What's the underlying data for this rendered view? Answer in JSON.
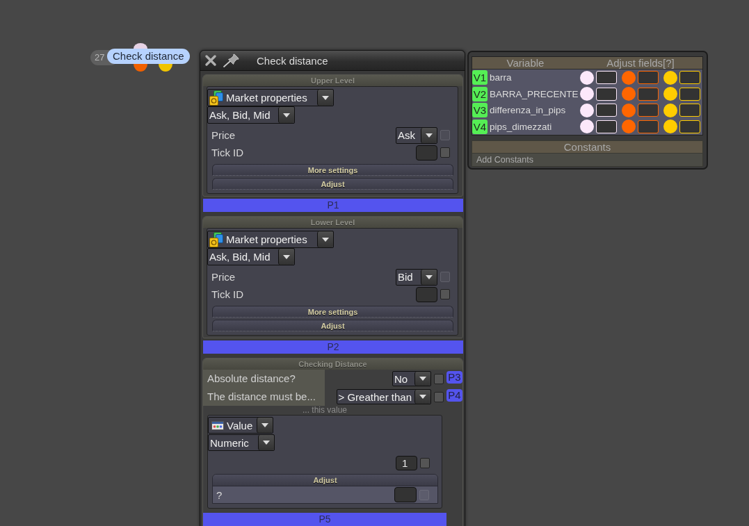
{
  "node": {
    "number": "27",
    "label": "Check distance",
    "ports": [
      {
        "color": "#e6d2e4"
      },
      {
        "color": "#f06000"
      },
      {
        "color": "#f0c400"
      }
    ]
  },
  "window": {
    "title": "Check distance"
  },
  "sections": [
    {
      "kind": "level",
      "title": "Upper Level",
      "source": "Market properties",
      "mode": "Ask, Bid, Mid",
      "fields": [
        {
          "kind": "select",
          "label": "Price",
          "value": "Ask",
          "checked": false,
          "disabled": true
        },
        {
          "kind": "input",
          "label": "Tick ID",
          "checked": false,
          "disabled": false
        }
      ],
      "buttons": [
        "More settings",
        "Adjust"
      ],
      "param": "P1"
    },
    {
      "kind": "level",
      "title": "Lower Level",
      "source": "Market properties",
      "mode": "Ask, Bid, Mid",
      "fields": [
        {
          "kind": "select",
          "label": "Price",
          "value": "Bid",
          "checked": false,
          "disabled": true
        },
        {
          "kind": "input",
          "label": "Tick ID",
          "checked": false,
          "disabled": false
        }
      ],
      "buttons": [
        "More settings",
        "Adjust"
      ],
      "param": "P2"
    },
    {
      "kind": "checks",
      "title": "Checking Distance",
      "rows": [
        {
          "label": "Absolute distance?",
          "value": "No",
          "checked": false,
          "disabled": false,
          "param": "P3"
        },
        {
          "label": "The distance must be...",
          "value": "> Greather than",
          "checked": false,
          "disabled": false,
          "param": "P4"
        }
      ],
      "caption": "... this value",
      "operand": {
        "source": "Value",
        "mode": "Numeric",
        "value": "1",
        "checked": false,
        "disabled": false,
        "adjust": {
          "title": "Adjust",
          "rows": [
            {
              "label": "?",
              "checked": false,
              "disabled": true
            }
          ]
        }
      },
      "param": "P5"
    }
  ],
  "variables": {
    "columns": [
      "Variable",
      "Adjust fields[?]"
    ],
    "slots": [
      {
        "color": "#fce8fa"
      },
      {
        "color": "#ff6600"
      },
      {
        "color": "#ffcc00"
      }
    ],
    "rows": [
      {
        "id": "V1",
        "name": "barra"
      },
      {
        "id": "V2",
        "name": "BARRA_PRECENTE"
      },
      {
        "id": "V3",
        "name": "differenza_in_pips"
      },
      {
        "id": "V4",
        "name": "pips_dimezzati"
      }
    ]
  },
  "constants": {
    "title": "Constants",
    "action": "Add Constants"
  }
}
